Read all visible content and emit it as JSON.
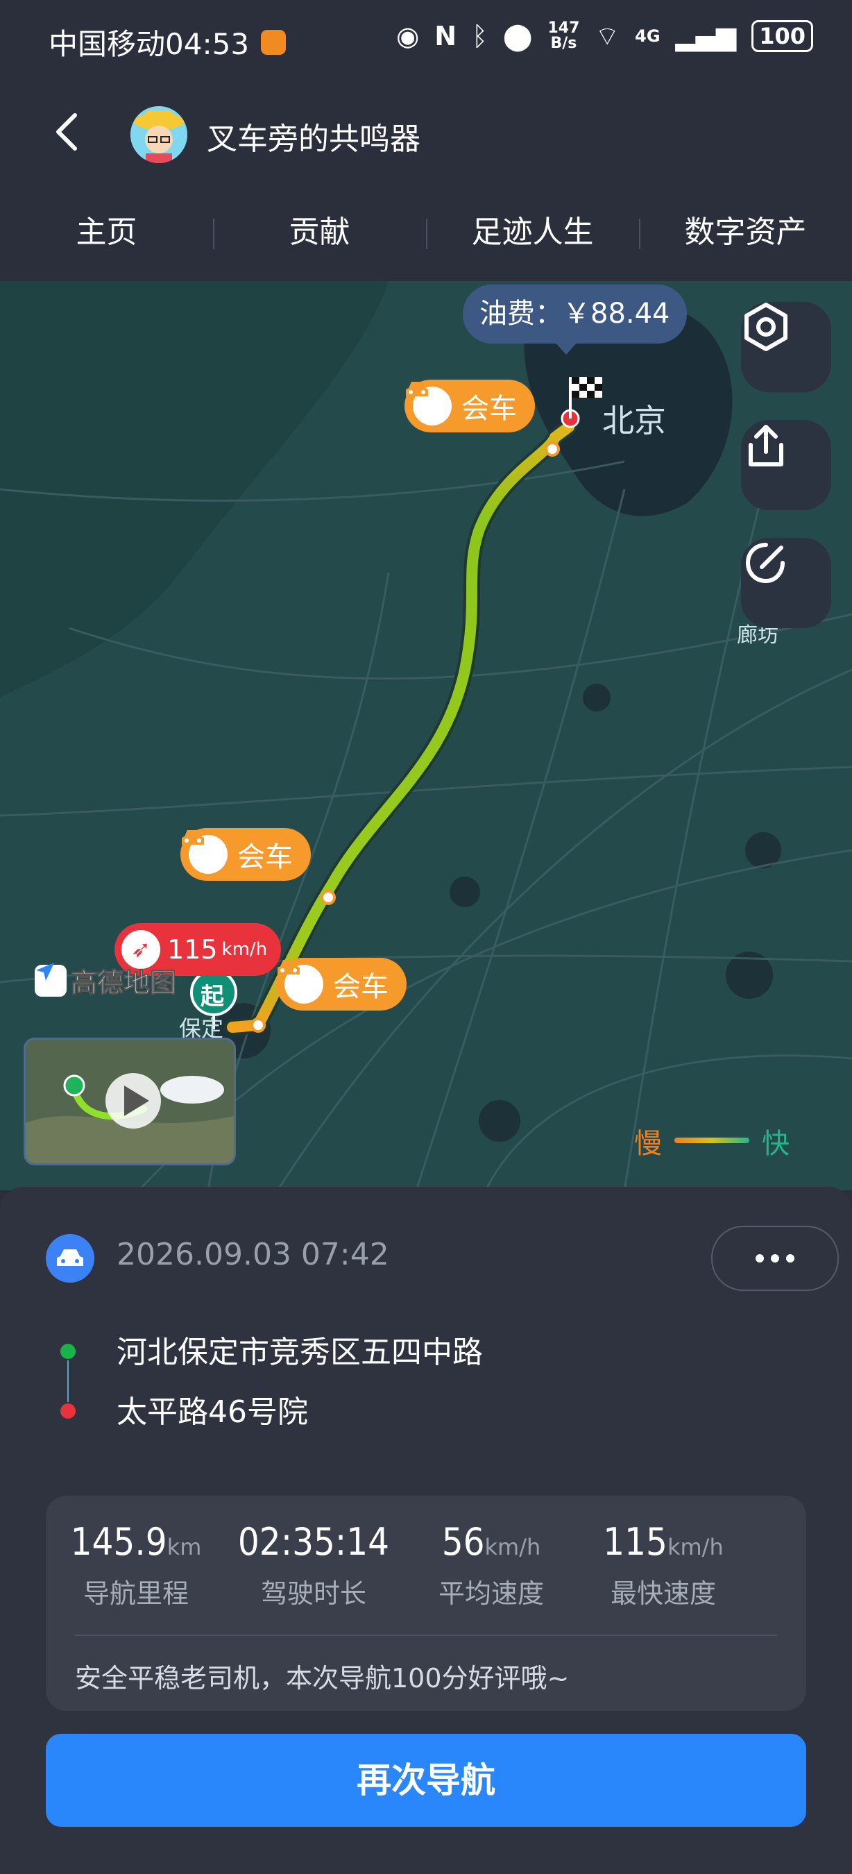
{
  "status_bar": {
    "carrier": "中国移动",
    "time": "04:53",
    "net_speed_top": "147",
    "net_speed_unit": "B/s",
    "network": "4G",
    "battery": "100"
  },
  "header": {
    "title": "叉车旁的共鸣器"
  },
  "tabs": [
    {
      "label": "主页"
    },
    {
      "label": "贡献"
    },
    {
      "label": "足迹人生"
    },
    {
      "label": "数字资产"
    }
  ],
  "map": {
    "fuel_label": "油费：￥88.44",
    "city_label": "北京",
    "langfang_label": "廊坊",
    "baoding_label": "保定",
    "start_marker": "起",
    "meet_label": "会车",
    "speed_badge_value": "115",
    "speed_badge_unit": "km/h",
    "logo_text": "高德地图",
    "legend_slow": "慢",
    "legend_fast": "快"
  },
  "trip": {
    "datetime": "2026.09.03 07:42",
    "start_address": "河北保定市竞秀区五四中路",
    "end_address": "太平路46号院"
  },
  "stats": [
    {
      "value": "145.9",
      "unit": "km",
      "label": "导航里程"
    },
    {
      "value": "02:35:14",
      "unit": "",
      "label": "驾驶时长"
    },
    {
      "value": "56",
      "unit": "km/h",
      "label": "平均速度"
    },
    {
      "value": "115",
      "unit": "km/h",
      "label": "最快速度"
    }
  ],
  "comment": "安全平稳老司机，本次导航100分好评哦~",
  "nav_button": "再次导航",
  "colors": {
    "background": "#2a2f3b",
    "accent": "#2a86fb",
    "meet_bubble": "#f59a2b",
    "speed_badge": "#e8323c",
    "start_dot": "#19b34a",
    "end_dot": "#e8323c"
  }
}
